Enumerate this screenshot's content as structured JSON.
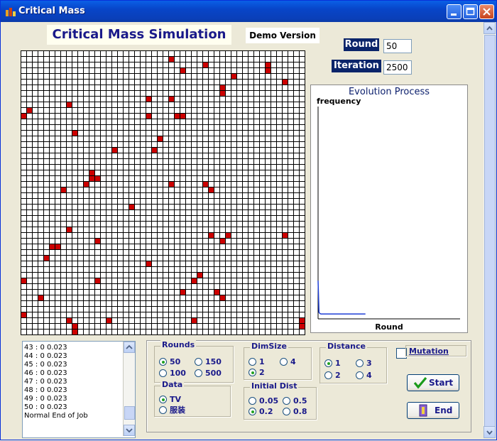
{
  "window": {
    "title": "Critical Mass"
  },
  "header": {
    "title": "Critical Mass Simulation",
    "demo_label": "Demo Version"
  },
  "round_field": {
    "label": "Round",
    "value": "50"
  },
  "iteration_field": {
    "label": "Iteration",
    "value": "2500"
  },
  "chart": {
    "title": "Evolution Process",
    "ylabel": "frequency",
    "xlabel": "Round"
  },
  "chart_data": {
    "type": "line",
    "title": "Evolution Process",
    "xlabel": "Round",
    "ylabel": "frequency",
    "series": [
      {
        "color": "#1f3fd6",
        "x": [
          0,
          1,
          2,
          3,
          4,
          50
        ],
        "y": [
          0.18,
          0.03,
          0.025,
          0.023,
          0.023,
          0.023
        ]
      }
    ],
    "xlim": [
      0,
      150
    ],
    "ylim": [
      0,
      1
    ]
  },
  "grid_data": {
    "size": 50,
    "red_cells": [
      [
        26,
        1
      ],
      [
        32,
        2
      ],
      [
        43,
        2
      ],
      [
        28,
        3
      ],
      [
        43,
        3
      ],
      [
        37,
        4
      ],
      [
        46,
        5
      ],
      [
        35,
        6
      ],
      [
        35,
        7
      ],
      [
        22,
        8
      ],
      [
        26,
        8
      ],
      [
        8,
        9
      ],
      [
        1,
        10
      ],
      [
        0,
        11
      ],
      [
        22,
        11
      ],
      [
        27,
        11
      ],
      [
        28,
        11
      ],
      [
        9,
        14
      ],
      [
        24,
        15
      ],
      [
        16,
        17
      ],
      [
        23,
        17
      ],
      [
        12,
        21
      ],
      [
        12,
        22
      ],
      [
        13,
        22
      ],
      [
        11,
        23
      ],
      [
        26,
        23
      ],
      [
        32,
        23
      ],
      [
        7,
        24
      ],
      [
        33,
        24
      ],
      [
        19,
        27
      ],
      [
        8,
        31
      ],
      [
        33,
        32
      ],
      [
        36,
        32
      ],
      [
        46,
        32
      ],
      [
        13,
        33
      ],
      [
        35,
        33
      ],
      [
        5,
        34
      ],
      [
        6,
        34
      ],
      [
        4,
        36
      ],
      [
        22,
        37
      ],
      [
        31,
        39
      ],
      [
        0,
        40
      ],
      [
        13,
        40
      ],
      [
        30,
        40
      ],
      [
        28,
        42
      ],
      [
        34,
        42
      ],
      [
        3,
        43
      ],
      [
        35,
        43
      ],
      [
        0,
        46
      ],
      [
        8,
        47
      ],
      [
        15,
        47
      ],
      [
        30,
        47
      ],
      [
        49,
        47
      ],
      [
        49,
        48
      ],
      [
        9,
        48
      ],
      [
        9,
        49
      ]
    ]
  },
  "log": {
    "lines": [
      "43 : 0   0.023",
      "44 : 0   0.023",
      "45 : 0   0.023",
      "46 : 0   0.023",
      "47 : 0   0.023",
      "48 : 0   0.023",
      "49 : 0   0.023",
      "50 : 0   0.023",
      "Normal End of Job"
    ]
  },
  "rounds": {
    "title": "Rounds",
    "options": [
      "50",
      "150",
      "100",
      "500"
    ],
    "selected": "50"
  },
  "dimsize": {
    "title": "DimSize",
    "options": [
      "1",
      "4",
      "2"
    ],
    "selected": "2"
  },
  "distance": {
    "title": "Distance",
    "options": [
      "1",
      "3",
      "2",
      "4"
    ],
    "selected": "1"
  },
  "data": {
    "title": "Data",
    "options": [
      "TV",
      "服装"
    ],
    "selected": "TV"
  },
  "initial_dist": {
    "title": "Initial Dist",
    "options": [
      "0.05",
      "0.5",
      "0.2",
      "0.8"
    ],
    "selected": "0.2"
  },
  "mutation": {
    "label": "Mutation",
    "checked": false
  },
  "buttons": {
    "start": "Start",
    "end": "End"
  }
}
